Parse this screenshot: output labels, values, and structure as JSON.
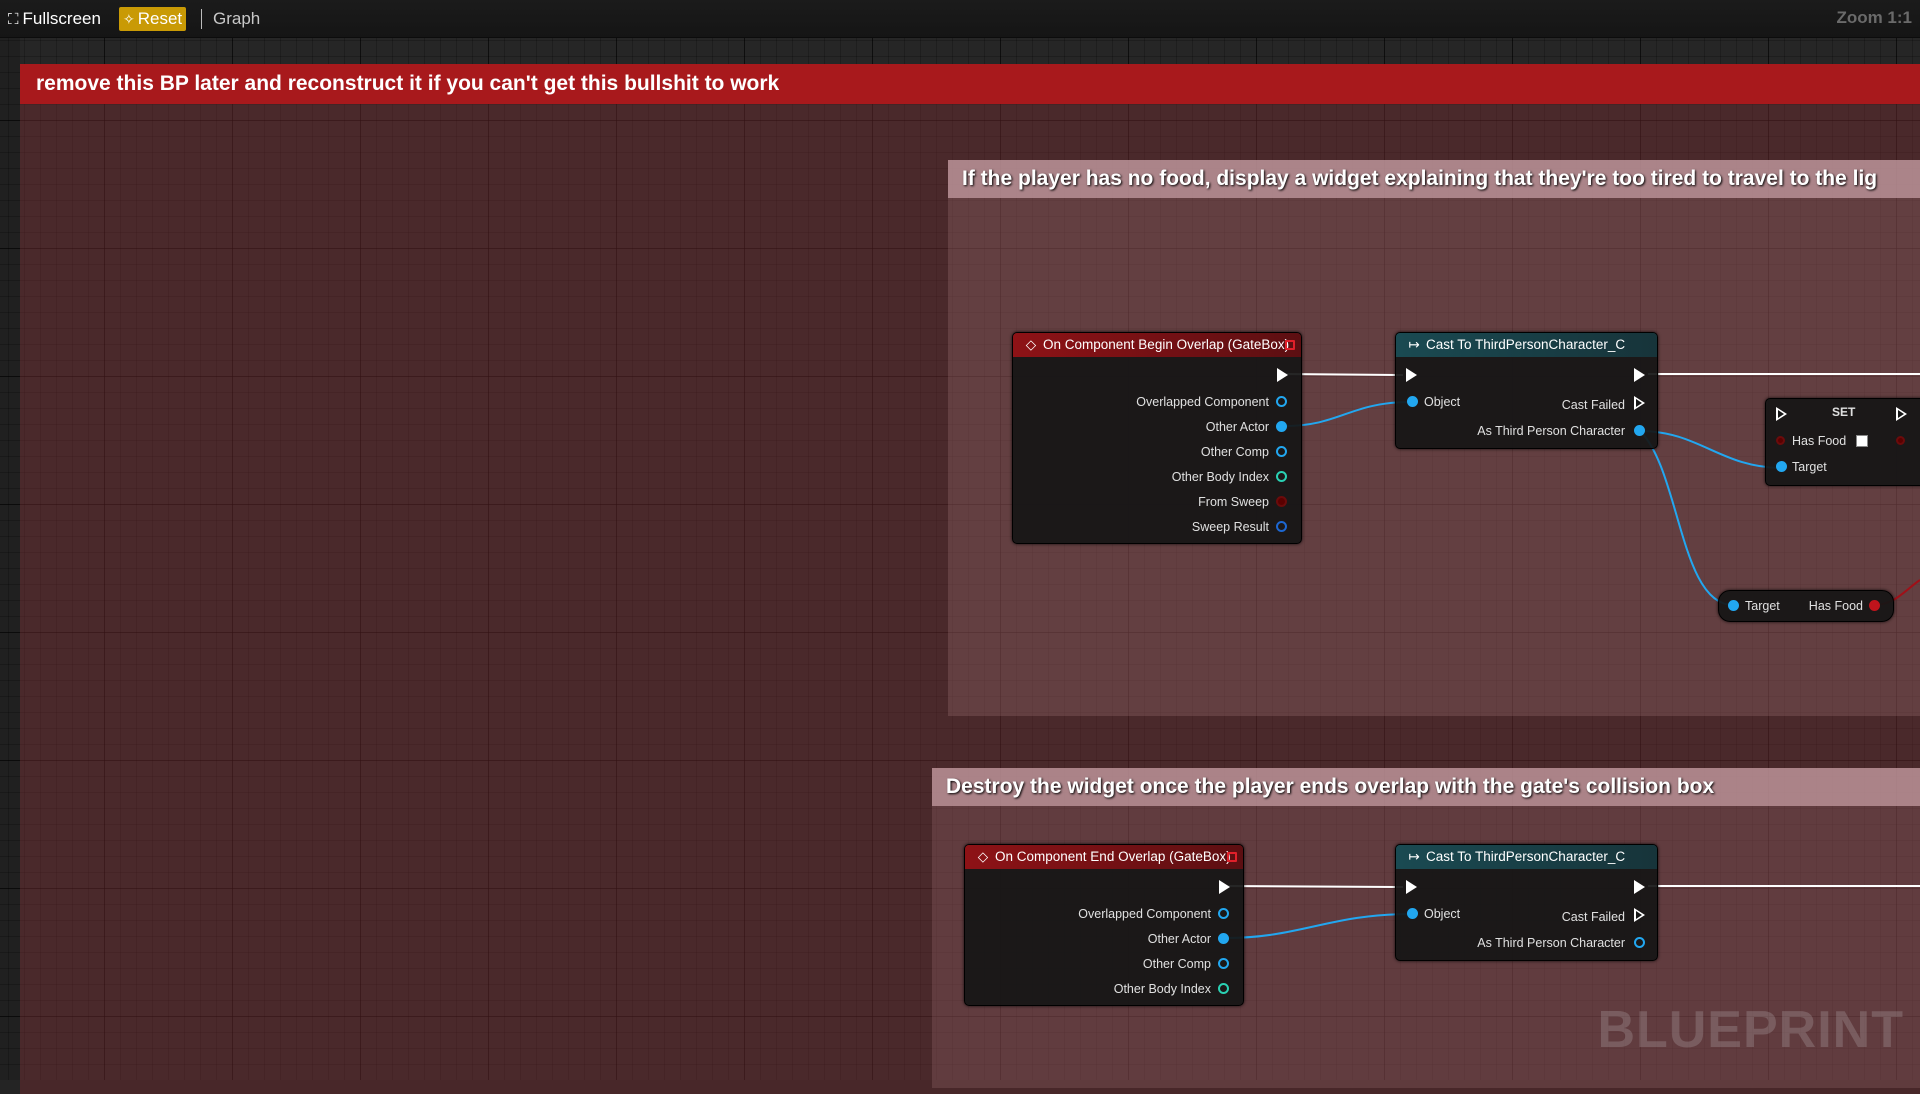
{
  "toolbar": {
    "fullscreen_label": "Fullscreen",
    "reset_label": "Reset",
    "graph_label": "Graph",
    "zoom_label": "Zoom 1:1"
  },
  "comments": {
    "main": "remove this BP later and reconstruct it if you can't get this bullshit to work",
    "food": "If the player has no food, display a widget explaining that they're too tired to travel to the lig",
    "destroy": "Destroy the widget once the player ends overlap with the gate's collision box"
  },
  "nodes": {
    "begin_overlap": {
      "title": "On Component Begin Overlap (GateBox)",
      "pins": [
        "Overlapped Component",
        "Other Actor",
        "Other Comp",
        "Other Body Index",
        "From Sweep",
        "Sweep Result"
      ]
    },
    "cast_1": {
      "title": "Cast To ThirdPersonCharacter_C",
      "object_label": "Object",
      "cast_failed_label": "Cast Failed",
      "as_label": "As Third Person Character"
    },
    "set_node": {
      "title": "SET",
      "has_food_label": "Has Food",
      "target_label": "Target"
    },
    "get_has_food": {
      "target_label": "Target",
      "has_food_label": "Has Food"
    },
    "end_overlap": {
      "title": "On Component End Overlap (GateBox)",
      "pins": [
        "Overlapped Component",
        "Other Actor",
        "Other Comp",
        "Other Body Index"
      ]
    },
    "cast_2": {
      "title": "Cast To ThirdPersonCharacter_C",
      "object_label": "Object",
      "cast_failed_label": "Cast Failed",
      "as_label": "As Third Person Character"
    }
  },
  "watermark": "BLUEPRINT",
  "colors": {
    "exec_wire": "#ffffff",
    "object_wire": "#22a7f0",
    "bool_wire": "#a01018",
    "event_header": "#8e1216",
    "cast_header": "#1a4a52",
    "main_comment": "#a8191c",
    "reset_button": "#c99a05"
  }
}
